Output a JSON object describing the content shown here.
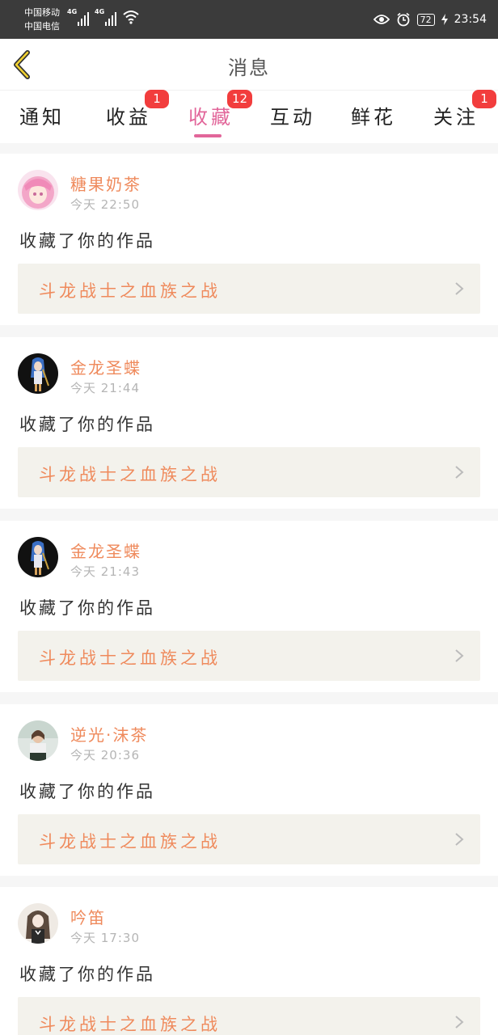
{
  "status_bar": {
    "carrier_1": "中国移动",
    "carrier_2": "中国电信",
    "network_1": "4G",
    "network_2": "4G",
    "battery": "72",
    "time": "23:54"
  },
  "header": {
    "title": "消息"
  },
  "tabs": [
    {
      "label": "通知",
      "badge": ""
    },
    {
      "label": "收益",
      "badge": "1"
    },
    {
      "label": "收藏",
      "badge": "12",
      "active": true
    },
    {
      "label": "互动",
      "badge": ""
    },
    {
      "label": "鲜花",
      "badge": ""
    },
    {
      "label": "关注",
      "badge": "1"
    }
  ],
  "messages": [
    {
      "user": "糖果奶茶",
      "time": "今天 22:50",
      "action": "收藏了你的作品",
      "work": "斗龙战士之血族之战",
      "avatar": "pink-hair-avatar"
    },
    {
      "user": "金龙圣蝶",
      "time": "今天 21:44",
      "action": "收藏了你的作品",
      "work": "斗龙战士之血族之战",
      "avatar": "blue-hair-avatar"
    },
    {
      "user": "金龙圣蝶",
      "time": "今天 21:43",
      "action": "收藏了你的作品",
      "work": "斗龙战士之血族之战",
      "avatar": "blue-hair-avatar"
    },
    {
      "user": "逆光·沫茶",
      "time": "今天 20:36",
      "action": "收藏了你的作品",
      "work": "斗龙战士之血族之战",
      "avatar": "photo-avatar"
    },
    {
      "user": "吟笛",
      "time": "今天 17:30",
      "action": "收藏了你的作品",
      "work": "斗龙战士之血族之战",
      "avatar": "sketch-avatar"
    }
  ],
  "colors": {
    "accent_pink": "#e2669a",
    "username_orange": "#ef8a5c",
    "badge_red": "#f23d3d"
  }
}
